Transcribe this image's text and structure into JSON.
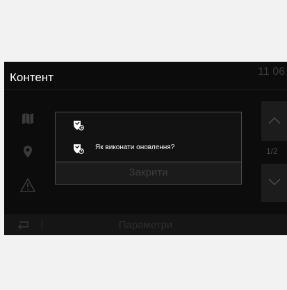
{
  "header": {
    "title": "Контент",
    "clock": "11 06"
  },
  "sidebar": {
    "icons": [
      "map-icon",
      "location-pin-icon",
      "warning-icon"
    ]
  },
  "pager": {
    "indicator": "1/2",
    "up_icon": "chevron-up-icon",
    "down_icon": "chevron-down-icon"
  },
  "dialog": {
    "rows": [
      {
        "icon": "shield-refresh-icon",
        "text": ""
      },
      {
        "icon": "shield-help-icon",
        "text": "Як виконати оновлення?"
      }
    ],
    "close_label": "Закрити"
  },
  "bottom_bar": {
    "back_icon": "back-arrow-icon",
    "settings_label": "Параметри"
  },
  "colors": {
    "background": "#0c0c0c",
    "text": "#ffffff",
    "dim_text": "#3c3c3c",
    "dialog_border": "#4b4b4b"
  }
}
